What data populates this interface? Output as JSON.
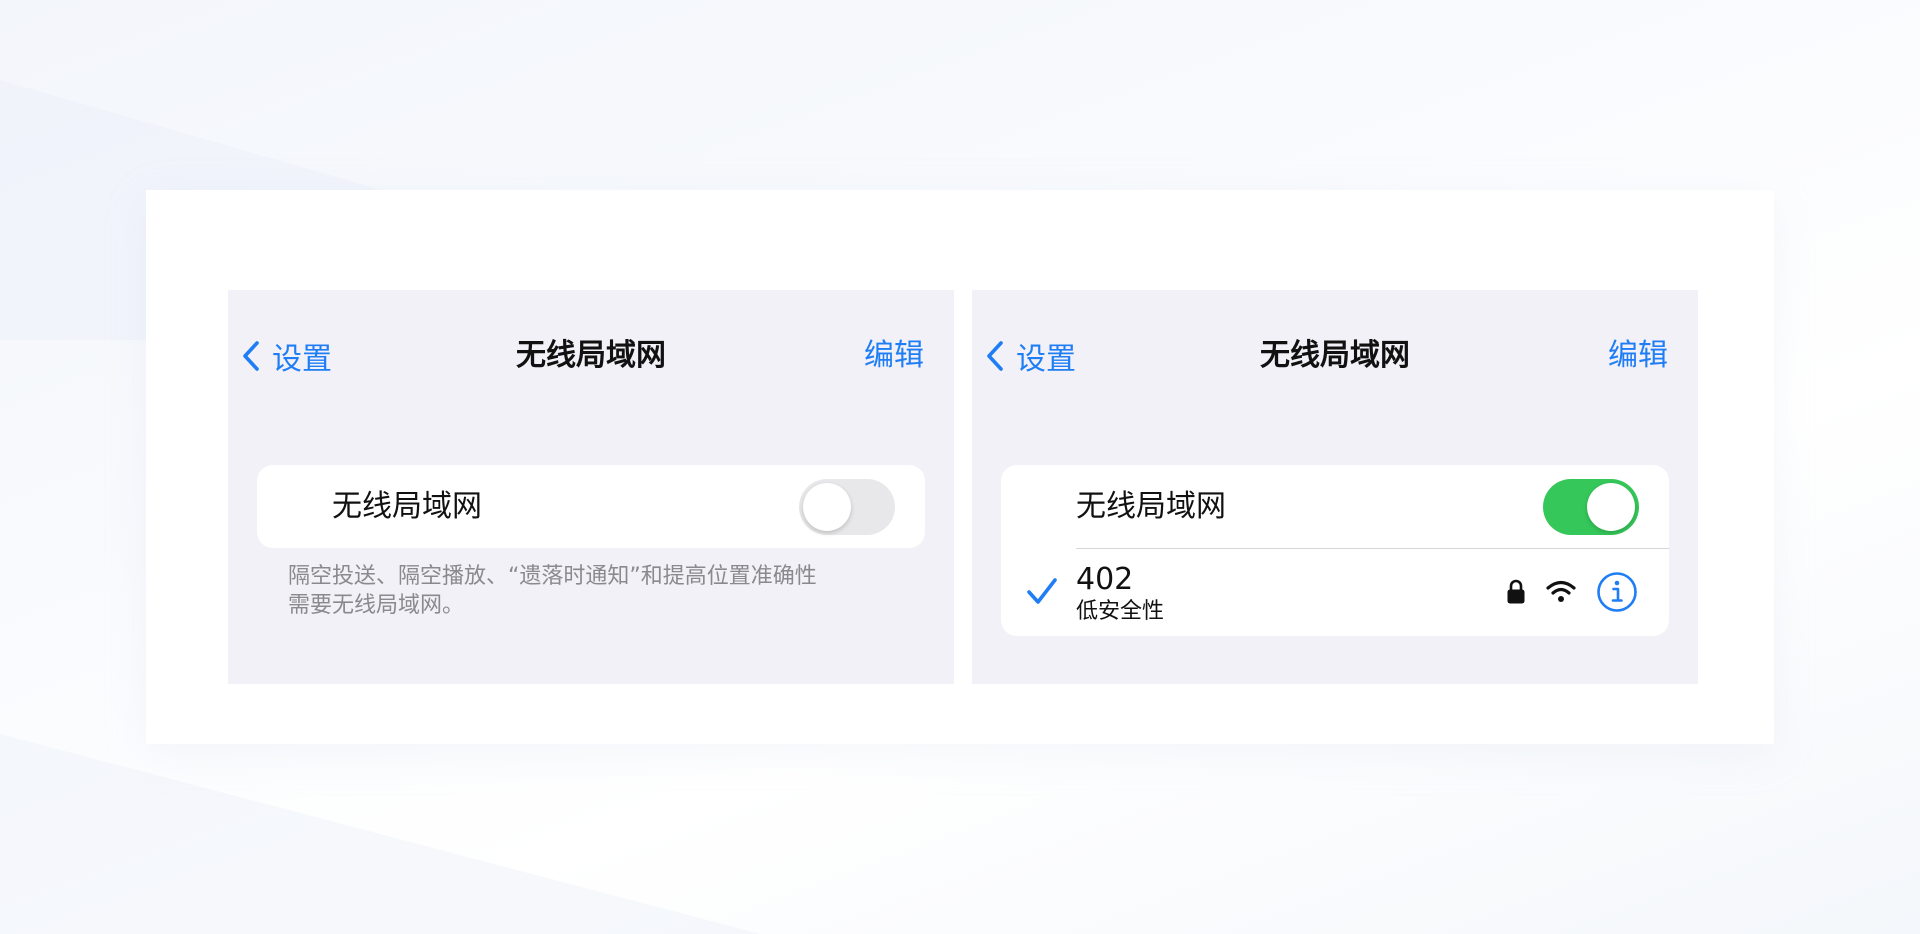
{
  "left_panel": {
    "nav": {
      "back_label": "设置",
      "title": "无线局域网",
      "edit_label": "编辑"
    },
    "wifi_row": {
      "label": "无线局域网",
      "toggle_state": "off"
    },
    "footnote_line1": "隔空投送、隔空播放、“遗落时通知”和提高位置准确性",
    "footnote_line2": "需要无线局域网。"
  },
  "right_panel": {
    "nav": {
      "back_label": "设置",
      "title": "无线局域网",
      "edit_label": "编辑"
    },
    "wifi_row": {
      "label": "无线局域网",
      "toggle_state": "on"
    },
    "network": {
      "name": "402",
      "subtitle": "低安全性",
      "connected": true
    }
  },
  "icons": {
    "back": "chevron-left-icon",
    "check": "checkmark-icon",
    "lock": "lock-icon",
    "wifi": "wifi-icon",
    "info": "info-icon"
  },
  "colors": {
    "accent": "#1f7ef5",
    "toggle_on": "#35c759",
    "toggle_off": "#e8e8ea",
    "panel_bg": "#f2f1f7",
    "footnote_text": "#8a8a8e"
  }
}
